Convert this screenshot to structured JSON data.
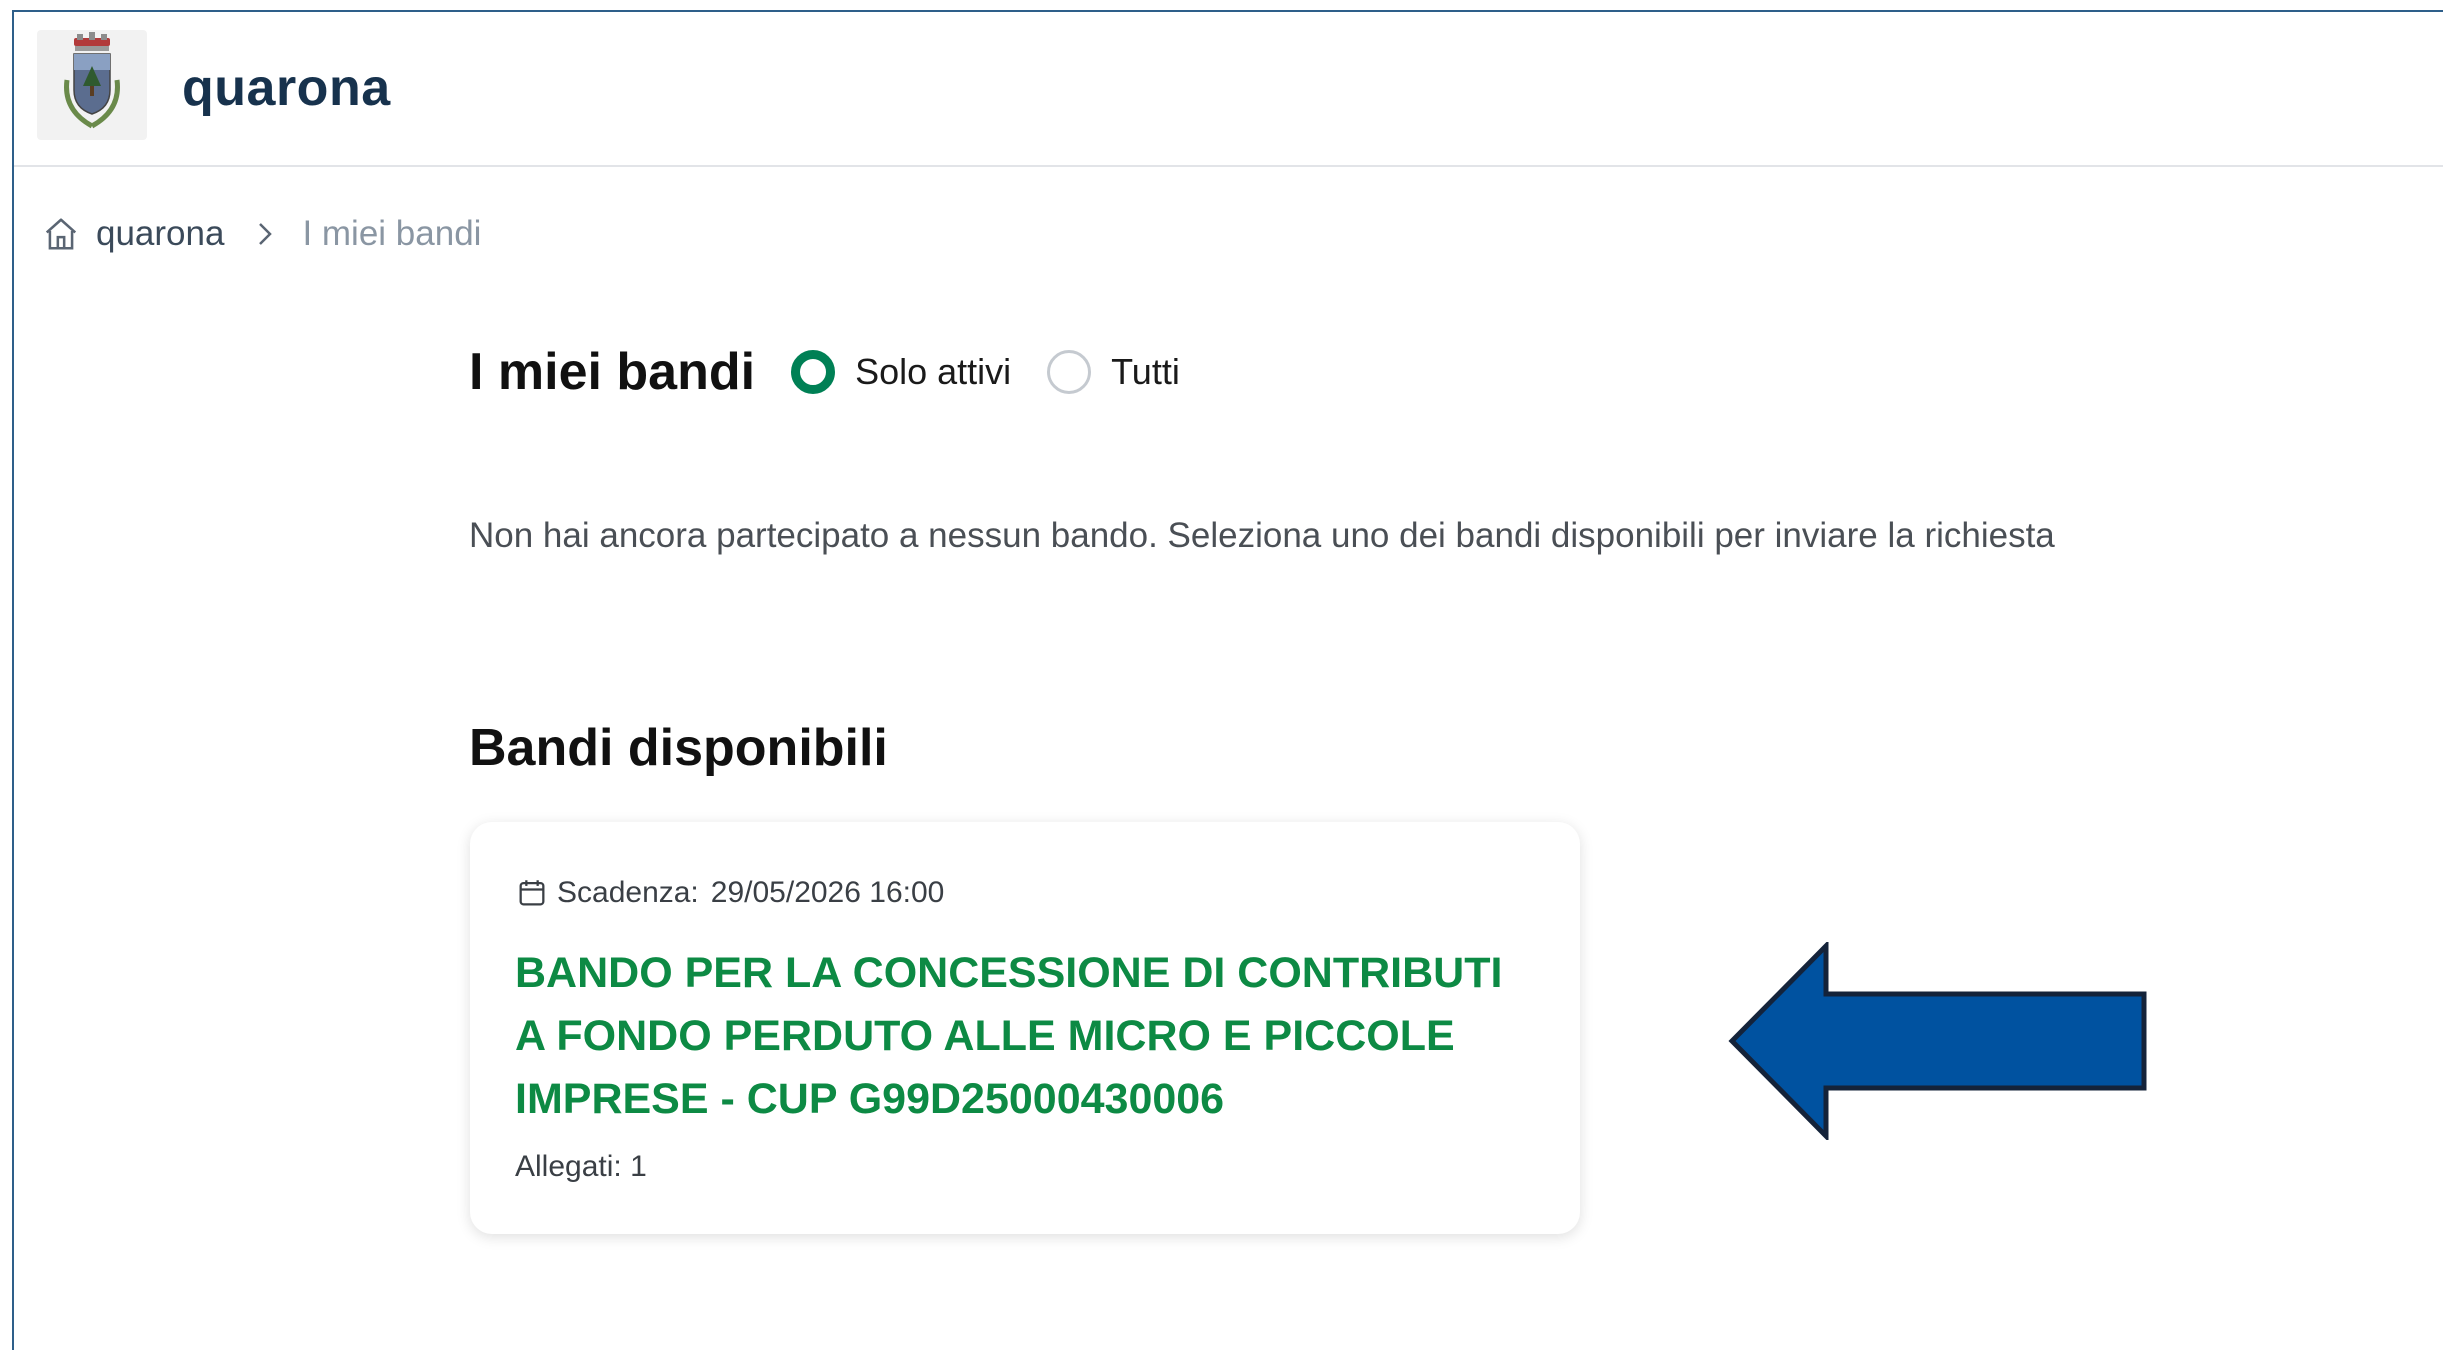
{
  "header": {
    "app_title": "quarona",
    "logo_icon": "coat-of-arms-icon"
  },
  "breadcrumb": {
    "home_label": "quarona",
    "current_label": "I miei bandi"
  },
  "my_calls": {
    "title": "I miei bandi",
    "filter_options": [
      {
        "label": "Solo attivi",
        "selected": true
      },
      {
        "label": "Tutti",
        "selected": false
      }
    ],
    "empty_message": "Non hai ancora partecipato a nessun bando. Seleziona uno dei bandi disponibili per inviare la richiesta"
  },
  "available_calls": {
    "title": "Bandi disponibili",
    "cards": [
      {
        "deadline_label": "Scadenza:",
        "deadline_value": "29/05/2026 16:00",
        "title": "BANDO PER LA CONCESSIONE DI CONTRIBUTI A FONDO PERDUTO ALLE MICRO E PICCOLE IMPRESE - CUP G99D25000430006",
        "attachments": "Allegati: 1"
      }
    ]
  },
  "colors": {
    "accent_green": "#0d8a44",
    "radio_green": "#008055",
    "arrow_blue": "#0052a0",
    "title_navy": "#17324d"
  }
}
